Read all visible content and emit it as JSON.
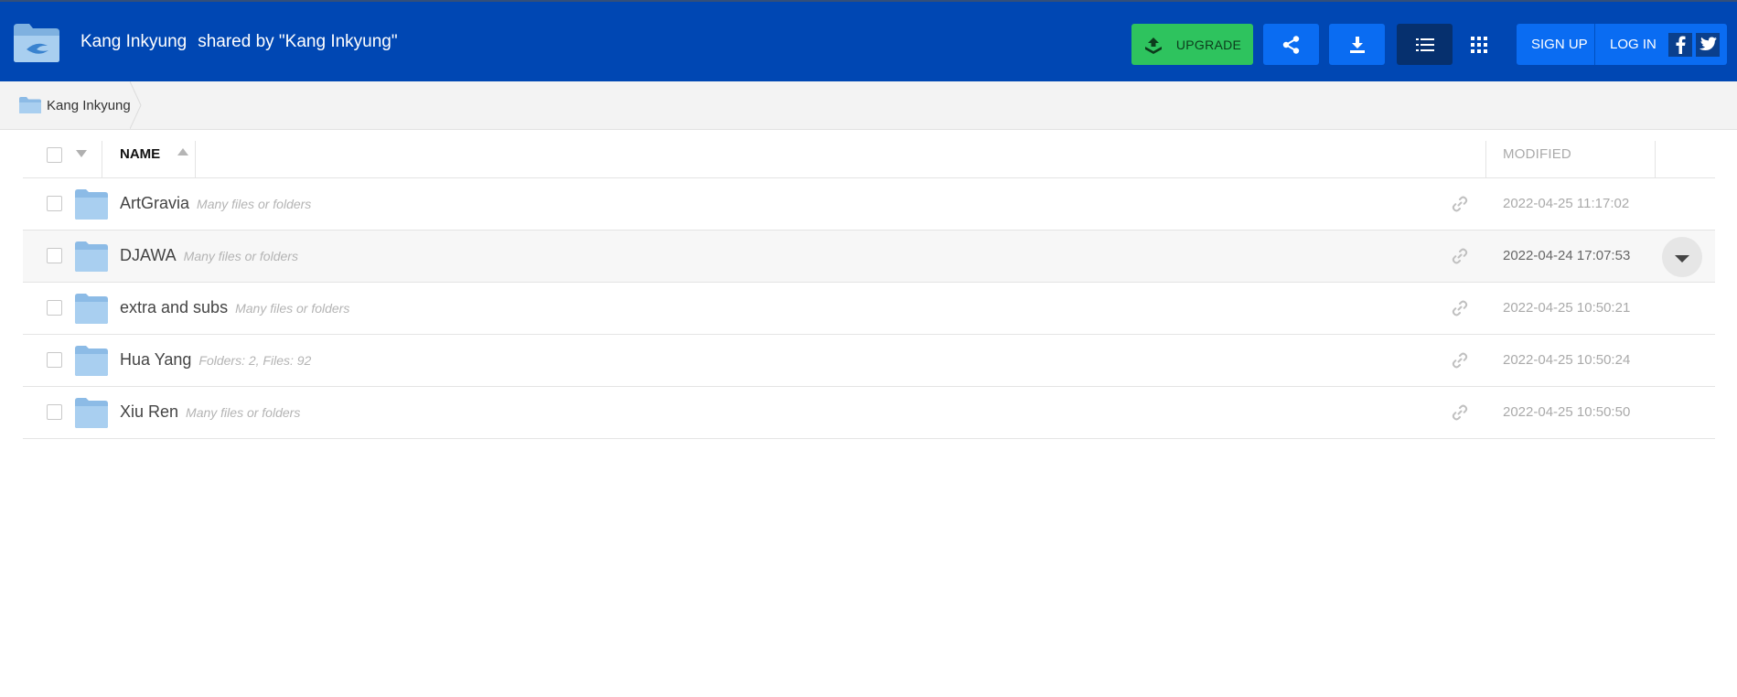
{
  "header": {
    "title_name": "Kang Inkyung",
    "title_shared": "shared by \"Kang Inkyung\"",
    "upgrade_label": "UPGRADE",
    "signup_label": "SIGN UP",
    "login_label": "LOG IN",
    "icons": {
      "logo": "folder-logo-icon",
      "upgrade": "upgrade-icon",
      "share": "share-icon",
      "download": "download-icon",
      "list": "list-view-icon",
      "grid": "grid-view-icon",
      "facebook": "facebook-icon",
      "twitter": "twitter-icon"
    }
  },
  "breadcrumb": {
    "items": [
      {
        "label": "Kang Inkyung"
      }
    ]
  },
  "table": {
    "columns": {
      "name": "NAME",
      "modified": "MODIFIED"
    },
    "sort": {
      "column": "name",
      "direction": "ascending"
    },
    "rows": [
      {
        "name": "ArtGravia",
        "meta": "Many files or folders",
        "modified": "2022-04-25 11:17:02"
      },
      {
        "name": "DJAWA",
        "meta": "Many files or folders",
        "modified": "2022-04-24 17:07:53"
      },
      {
        "name": "extra and subs",
        "meta": "Many files or folders",
        "modified": "2022-04-25 10:50:21"
      },
      {
        "name": "Hua Yang",
        "meta": "Folders: 2, Files: 92",
        "modified": "2022-04-25 10:50:24"
      },
      {
        "name": "Xiu Ren",
        "meta": "Many files or folders",
        "modified": "2022-04-25 10:50:50"
      }
    ]
  },
  "colors": {
    "header_bg": "#0047b3",
    "upgrade_bg": "#2ec35e",
    "button_bg": "#0a6cf2",
    "active_view_bg": "#06306e"
  }
}
